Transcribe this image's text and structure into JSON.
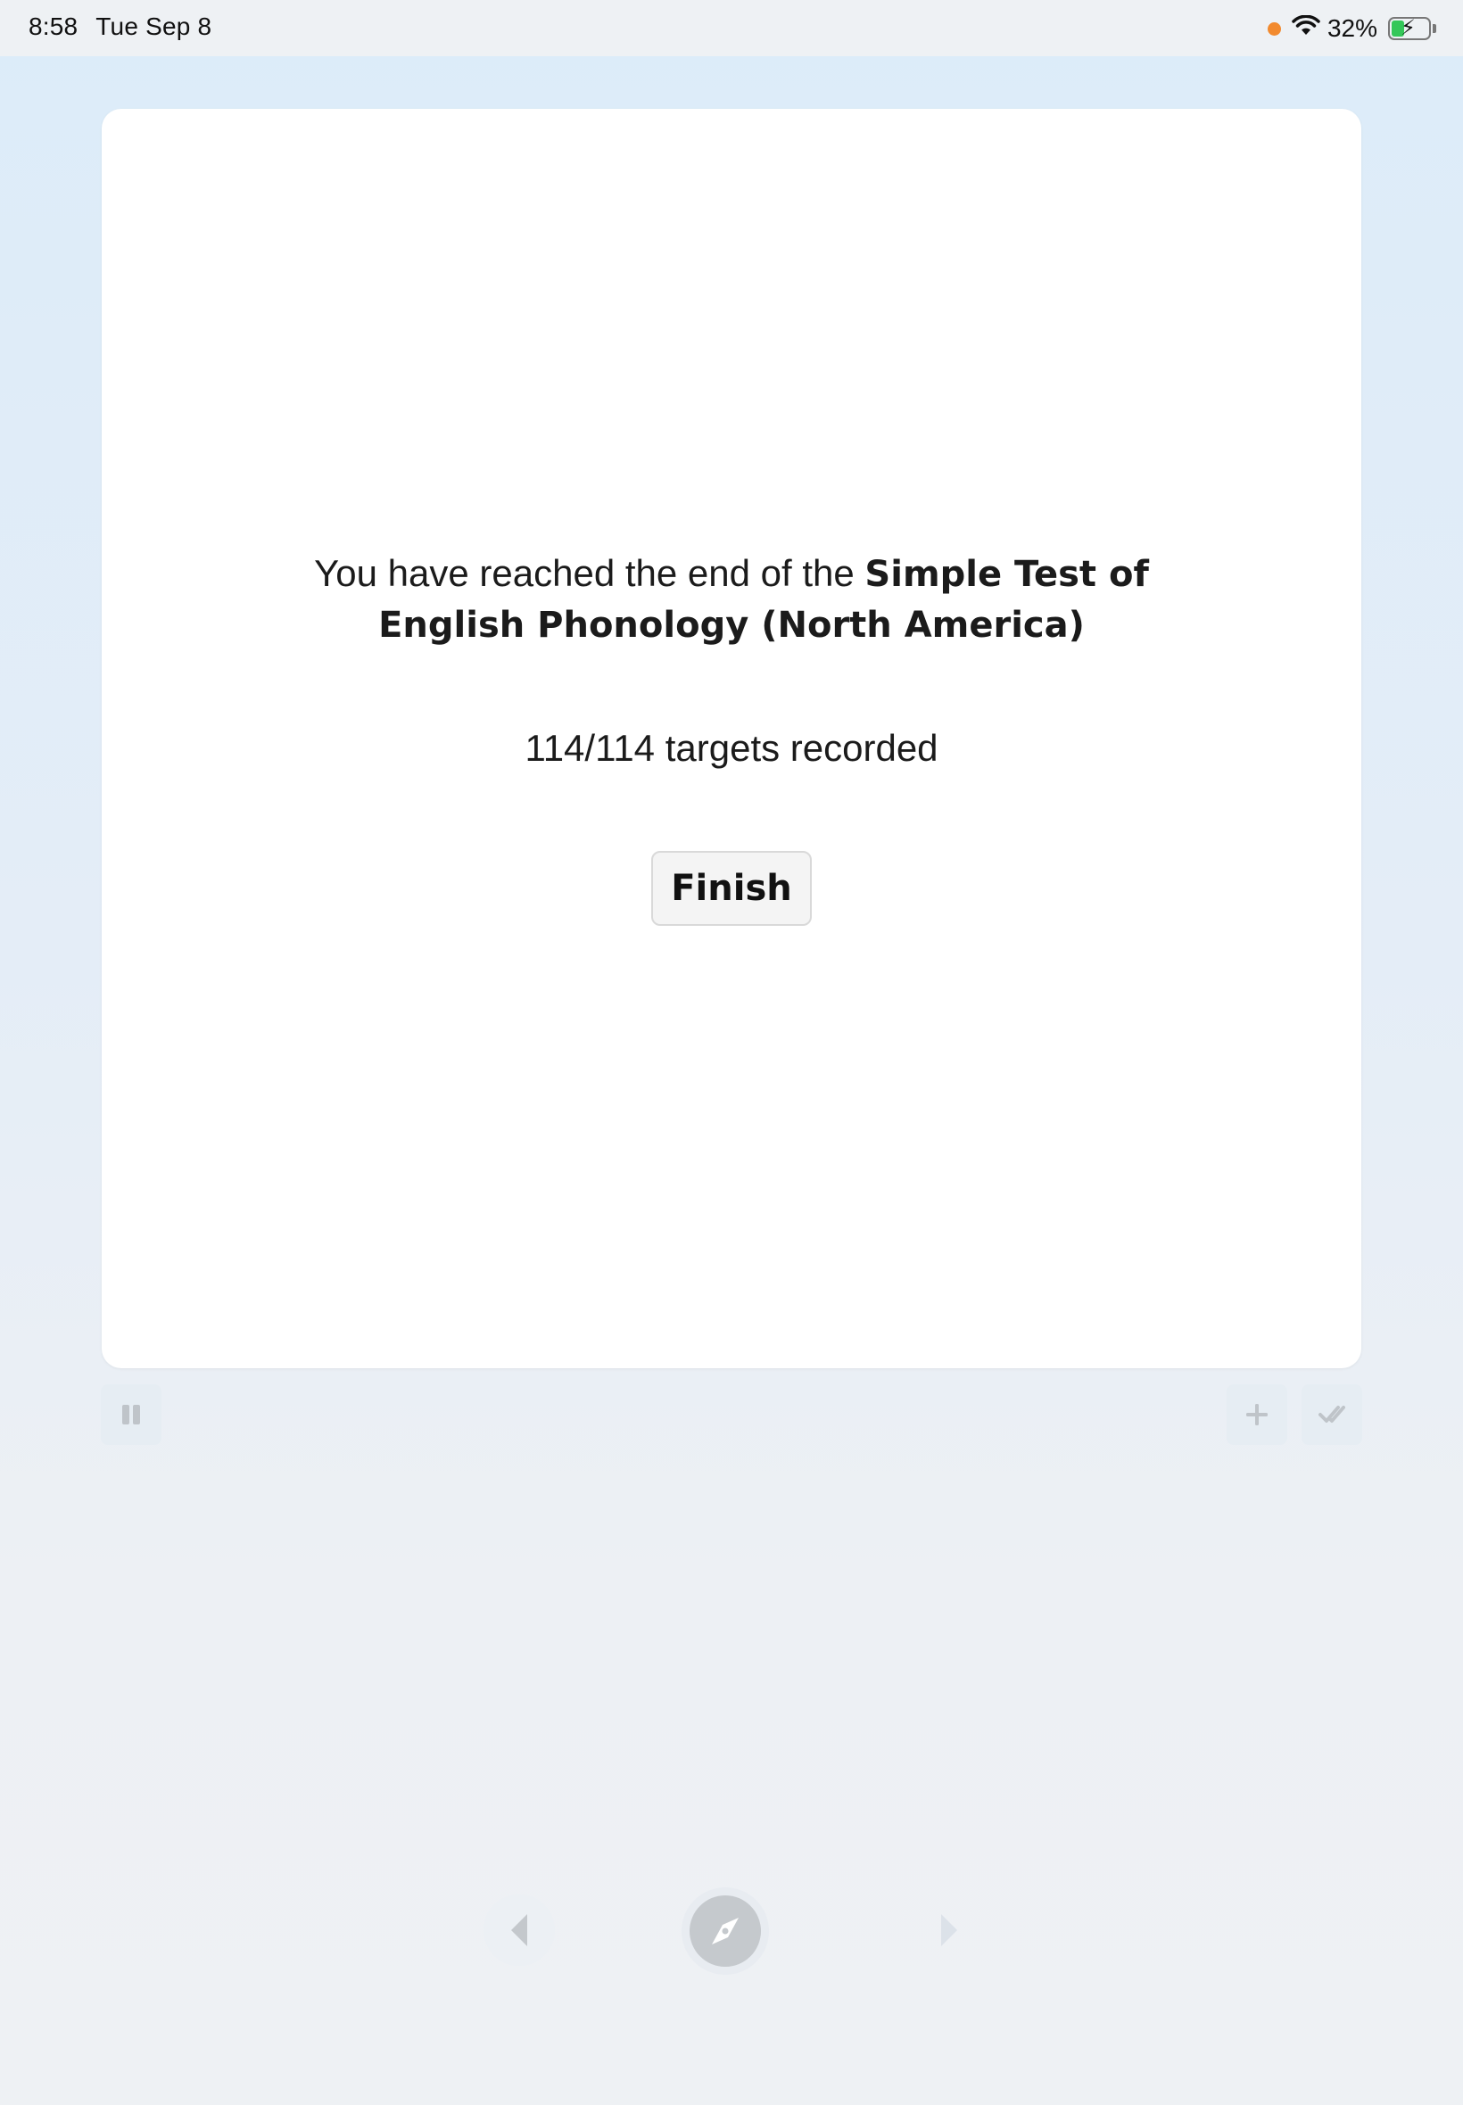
{
  "status_bar": {
    "time": "8:58",
    "date": "Tue Sep 8",
    "battery_percent": "32%",
    "battery_level": 0.32,
    "recording_indicator_color": "#f28a2e",
    "icons": [
      "wifi-icon",
      "battery-charging-icon"
    ]
  },
  "card": {
    "message_prefix": "You have reached the end of the ",
    "test_name": "Simple Test of English Phonology (North America)",
    "progress": "114/114 targets recorded",
    "finish_label": "Finish"
  },
  "toolbar": {
    "icons": [
      "pause-icon",
      "plus-icon",
      "double-check-icon"
    ]
  },
  "bottom_nav": {
    "icons": [
      "back-arrow-icon",
      "compass-icon",
      "forward-arrow-icon"
    ]
  }
}
